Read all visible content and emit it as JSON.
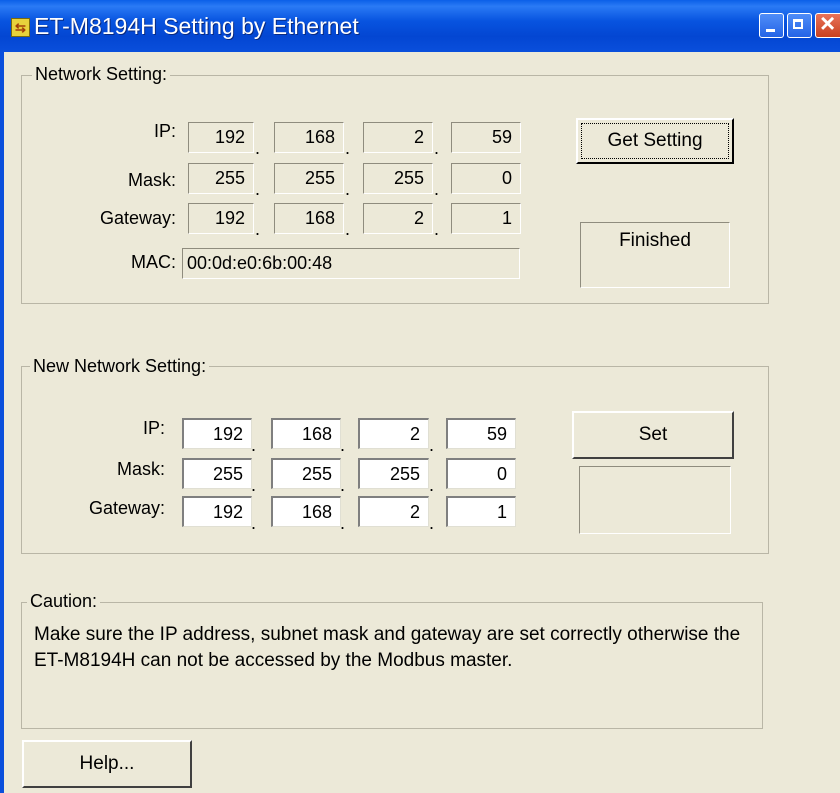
{
  "window": {
    "title": "ET-M8194H Setting by Ethernet",
    "app_icon": "network-setting-icon"
  },
  "network_setting": {
    "label": "Network Setting:",
    "ip_label": "IP:",
    "mask_label": "Mask:",
    "gateway_label": "Gateway:",
    "mac_label": "MAC:",
    "ip": [
      "192",
      "168",
      "2",
      "59"
    ],
    "mask": [
      "255",
      "255",
      "255",
      "0"
    ],
    "gateway": [
      "192",
      "168",
      "2",
      "1"
    ],
    "mac": "00:0d:e0:6b:00:48",
    "get_button": "Get Setting",
    "status": "Finished"
  },
  "new_network_setting": {
    "label": "New Network Setting:",
    "ip_label": "IP:",
    "mask_label": "Mask:",
    "gateway_label": "Gateway:",
    "ip": [
      "192",
      "168",
      "2",
      "59"
    ],
    "mask": [
      "255",
      "255",
      "255",
      "0"
    ],
    "gateway": [
      "192",
      "168",
      "2",
      "1"
    ],
    "set_button": "Set",
    "status": ""
  },
  "caution": {
    "label": "Caution:",
    "text": "Make sure the IP address, subnet mask and gateway are set correctly otherwise the ET-M8194H can not be accessed by the Modbus master."
  },
  "help_button": "Help..."
}
